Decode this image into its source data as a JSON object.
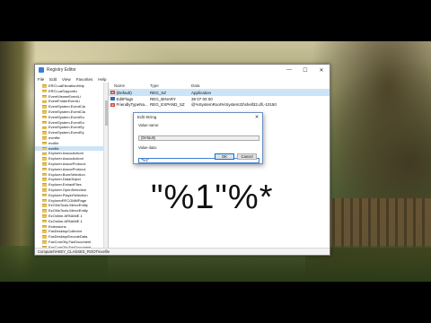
{
  "window": {
    "title": "Registry Editor",
    "minimize_glyph": "—",
    "maximize_glyph": "☐",
    "close_glyph": "✕",
    "menu": [
      "File",
      "Edit",
      "View",
      "Favorites",
      "Help"
    ]
  },
  "tree": {
    "items": [
      "ERCLuaElevationHelp",
      "ERCLuaSupportLi",
      "EventViewerEventLi",
      "EventFolderEventLi",
      "EventSystem.EventCla",
      "EventSystem.EventCla",
      "EventSystem.EventSu",
      "EventSystem.EventSu",
      "EventSystem.EventSy",
      "EventSystem.EventSy",
      "evmfile",
      "evxfile",
      "exefile",
      "Explorer.AssocActionI",
      "Explorer.AssocActionI",
      "Explorer.AssocProtocol",
      "Explorer.AssocProtocol",
      "Explorer.BurnSelection",
      "Explorer.DataObject",
      "Explorer.ExtractFiles",
      "Explorer.OpenSelection",
      "Explorer.PlayerSelection",
      "ExplorerRFCOMMPage",
      "EzCMsTools.MirrorEntity",
      "EzCMsTools.MirrorEntity",
      "EzOnline.ARNAME.1",
      "EzOnline.ARNAME.1",
      "Extensions",
      "FaxDesktopCollector",
      "FaxDesktopEncodeData",
      "FaxComObj.FaxDocument",
      "FaxComObj.FaxDocument"
    ],
    "selected_index": 12
  },
  "values": {
    "headers": {
      "name": "Name",
      "type": "Type",
      "data": "Data"
    },
    "rows": [
      {
        "name": "(Default)",
        "type": "REG_SZ",
        "data": "Application",
        "icon": "string-value-icon"
      },
      {
        "name": "EditFlags",
        "type": "REG_BINARY",
        "data": "38 07 00 00",
        "icon": "binary-value-icon"
      },
      {
        "name": "FriendlyTypeNa...",
        "type": "REG_EXPAND_SZ",
        "data": "@%SystemRoot%\\System32\\shell32.dll,-10150",
        "icon": "string-value-icon"
      }
    ]
  },
  "status": "Computer\\HKEY_CLASSES_ROOT\\exefile",
  "dialog": {
    "title": "Edit String",
    "close_glyph": "✕",
    "value_name_label": "Value name:",
    "value_name": "(Default)",
    "value_data_label": "Value data:",
    "value_data": "\"%1\"",
    "ok_label": "OK",
    "cancel_label": "Cancel"
  },
  "overlay": {
    "text": "\"%1\"%*"
  },
  "colors": {
    "selection": "#cce4f7",
    "accent": "#0078d7",
    "folder": "#e8c25a"
  }
}
